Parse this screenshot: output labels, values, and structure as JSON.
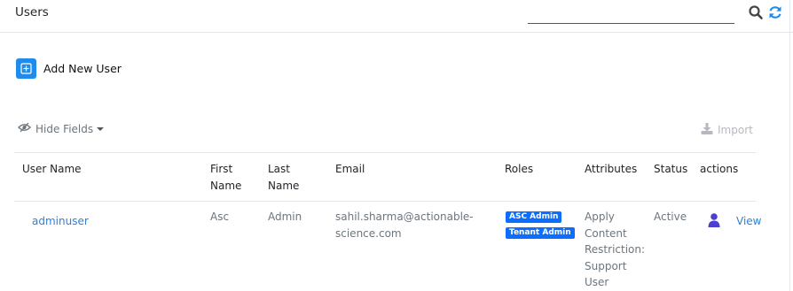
{
  "header": {
    "title": "Users",
    "search": {
      "value": "",
      "placeholder": ""
    },
    "icons": {
      "search": "search-icon",
      "refresh": "refresh-icon"
    }
  },
  "toolbar": {
    "add_user_label": "Add New User",
    "hide_fields_label": "Hide Fields",
    "import_label": "Import"
  },
  "table": {
    "columns": {
      "user_name": "User Name",
      "first_name_1": "First",
      "first_name_2": "Name",
      "last_name_1": "Last",
      "last_name_2": "Name",
      "email": "Email",
      "roles": "Roles",
      "attributes": "Attributes",
      "status": "Status",
      "actions": "actions"
    },
    "rows": [
      {
        "user_name": "adminuser",
        "first_name": "Asc",
        "last_name": "Admin",
        "email_1": "sahil.sharma@actionable-",
        "email_2": "science.com",
        "roles": [
          "ASC Admin",
          "Tenant Admin"
        ],
        "attributes": [
          "Apply",
          "Content",
          "Restriction:",
          "Support",
          "User"
        ],
        "status": "Active",
        "action_view": "View"
      }
    ]
  },
  "colors": {
    "accent": "#1f8ceb",
    "badge": "#0d6efd",
    "link": "#2f7fd6",
    "user_icon": "#4b3fd1",
    "muted": "#6c757d"
  }
}
